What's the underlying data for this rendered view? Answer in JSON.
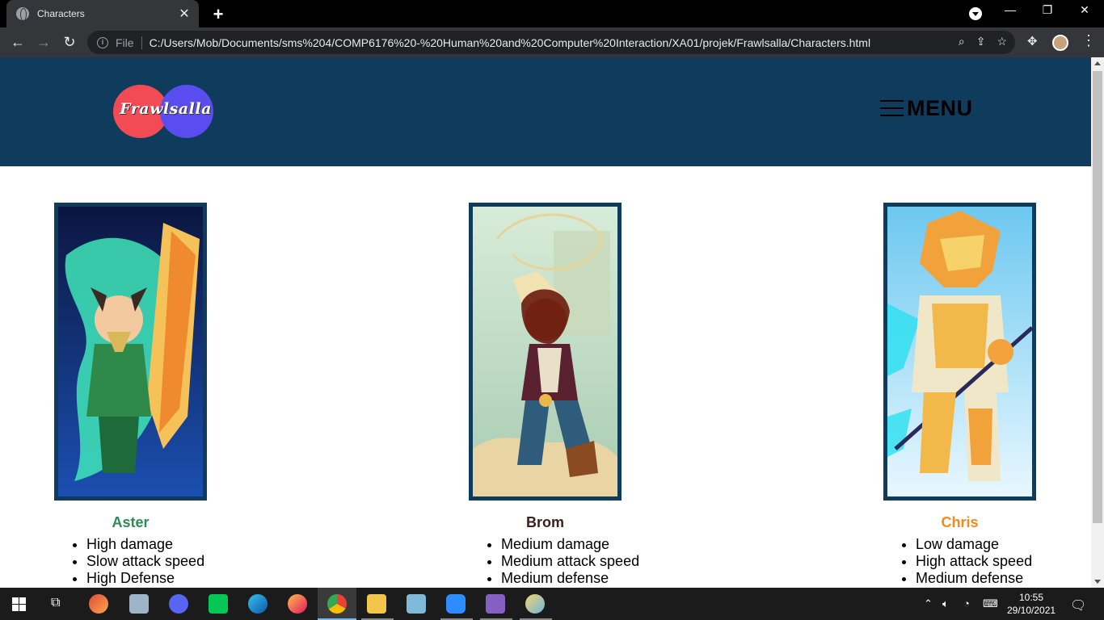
{
  "browser": {
    "tab_title": "Characters",
    "tab_close": "✕",
    "new_tab": "+",
    "window_controls": {
      "minimize": "—",
      "maximize": "❐",
      "close": "✕"
    },
    "address_label": "File",
    "url": "C:/Users/Mob/Documents/sms%204/COMP6176%20-%20Human%20and%20Computer%20Interaction/XA01/projek/Frawlsalla/Characters.html",
    "icons": [
      "back-icon",
      "forward-icon",
      "reload-icon",
      "info-icon",
      "zoom-icon",
      "share-icon",
      "star-icon",
      "extensions-icon",
      "profile-avatar",
      "kebab-menu-icon"
    ]
  },
  "site": {
    "logo_text": "Frawlsalla",
    "menu_label": "MENU",
    "colors": {
      "header_bg": "#0f3c5c",
      "logo_red": "#f24b55",
      "logo_purple": "#5a4df0"
    }
  },
  "characters": [
    {
      "name": "Aster",
      "color": "#2e8b57",
      "stats": [
        "High damage",
        "Slow attack speed",
        "High Defense"
      ]
    },
    {
      "name": "Brom",
      "color": "#3b1f1f",
      "stats": [
        "Medium damage",
        "Medium attack speed",
        "Medium defense"
      ]
    },
    {
      "name": "Chris",
      "color": "#f28a1e",
      "stats": [
        "Low damage",
        "High attack speed",
        "Medium defense"
      ]
    }
  ],
  "taskbar": {
    "apps": [
      "start-icon",
      "task-view-icon",
      "app-red-icon",
      "app-gallery-icon",
      "discord-icon",
      "line-icon",
      "edge-icon",
      "firefox-icon",
      "chrome-icon",
      "file-explorer-icon",
      "app-blue-icon",
      "zoom-icon",
      "visual-studio-icon",
      "paint-icon"
    ],
    "time": "10:55",
    "date": "29/10/2021"
  }
}
